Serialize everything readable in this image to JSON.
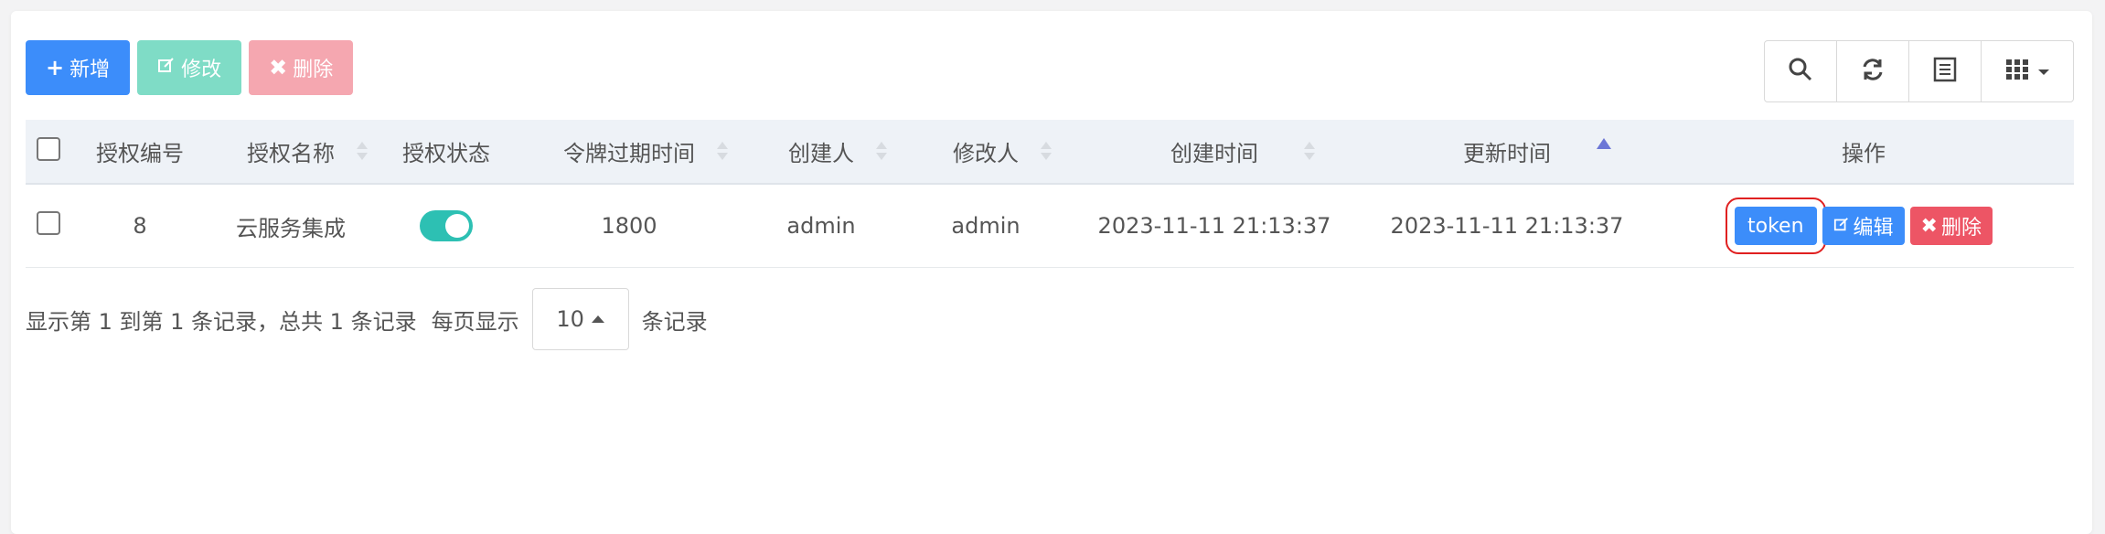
{
  "toolbar": {
    "add_label": "新增",
    "edit_label": "修改",
    "delete_label": "删除"
  },
  "table": {
    "columns": [
      "授权编号",
      "授权名称",
      "授权状态",
      "令牌过期时间",
      "创建人",
      "修改人",
      "创建时间",
      "更新时间",
      "操作"
    ],
    "rows": [
      {
        "id": "8",
        "name": "云服务集成",
        "status": "enabled",
        "expiry": "1800",
        "creator": "admin",
        "modifier": "admin",
        "created_at": "2023-11-11 21:13:37",
        "updated_at": "2023-11-11 21:13:37",
        "actions": {
          "token_label": "token",
          "edit_label": "编辑",
          "delete_label": "删除"
        }
      }
    ]
  },
  "pagination": {
    "summary": "显示第 1 到第 1 条记录，总共 1 条记录",
    "per_page_prefix": "每页显示",
    "page_size": "10",
    "per_page_suffix": "条记录"
  },
  "icons": {
    "add": "plus-icon",
    "edit": "edit-icon",
    "delete": "times-icon",
    "search": "search-icon",
    "refresh": "refresh-icon",
    "toggle_view": "list-icon",
    "columns": "grid-icon"
  },
  "colors": {
    "primary": "#3c8dfa",
    "success_light": "#7fdcc6",
    "danger_light": "#f5a7b0",
    "danger": "#ed5565",
    "toggle_on": "#2dc0b3",
    "highlight": "#e02020"
  }
}
